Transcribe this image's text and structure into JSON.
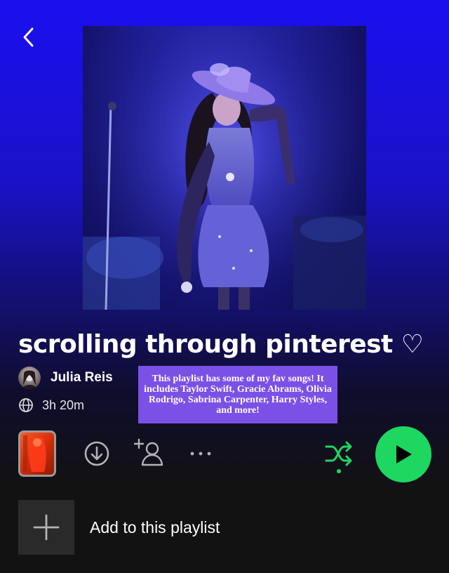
{
  "header": {
    "back_icon": "chevron-left-icon"
  },
  "cover": {
    "subject": "performer in sparkly purple dress and cowboy hat on stage"
  },
  "playlist": {
    "title": "scrolling through pinterest ♡",
    "owner": "Julia Reis",
    "duration": "3h 20m",
    "description": "This playlist has some of my fav songs! It includes Taylor Swift, Gracie Abrams, Olivia Rodrigo, Sabrina Carpenter, Harry Styles, and more!"
  },
  "actions": {
    "download_icon": "download-icon",
    "add_collaborator_icon": "add-user-icon",
    "more_icon": "more-options-icon",
    "shuffle_icon": "shuffle-icon",
    "play_icon": "play-icon"
  },
  "add_row": {
    "label": "Add to this playlist"
  },
  "colors": {
    "accent_green": "#1ed760",
    "header_blue": "#1a0ff0",
    "description_bg": "#7b50e6",
    "background": "#121212"
  }
}
